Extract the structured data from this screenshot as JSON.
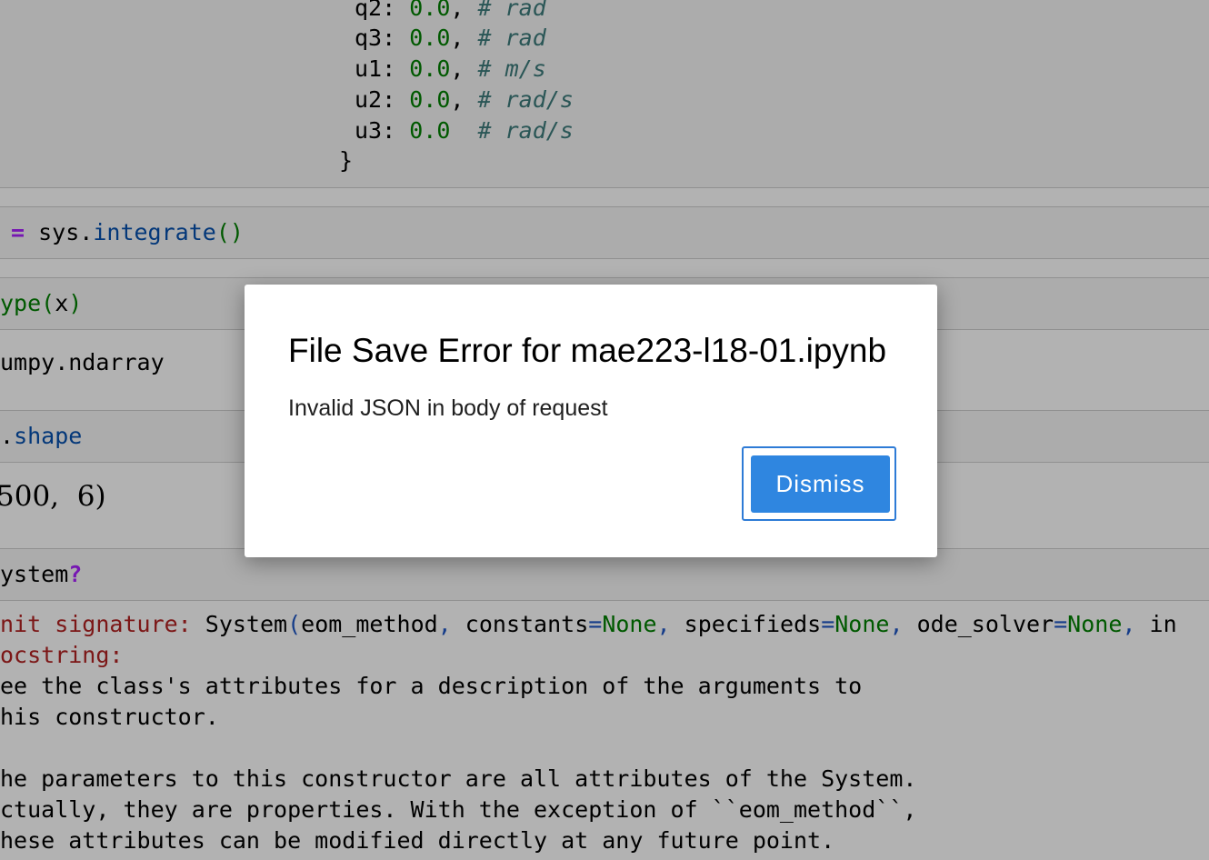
{
  "cell1": {
    "lines": [
      {
        "key": "q2",
        "value": "0.0",
        "sep": ",",
        "comment": "# rad"
      },
      {
        "key": "q3",
        "value": "0.0",
        "sep": ",",
        "comment": "# rad"
      },
      {
        "key": "u1",
        "value": "0.0",
        "sep": ",",
        "comment": "# m/s"
      },
      {
        "key": "u2",
        "value": "0.0",
        "sep": ",",
        "comment": "# rad/s"
      },
      {
        "key": "u3",
        "value": "0.0",
        "sep": " ",
        "comment": "# rad/s"
      }
    ],
    "closing": "}"
  },
  "cell2": {
    "op": "=",
    "obj": "sys",
    "dot": ".",
    "method": "integrate",
    "parens": "()"
  },
  "cell3": {
    "func": "ype",
    "open": "(",
    "arg": "x",
    "close": ")",
    "output": "umpy.ndarray"
  },
  "cell4": {
    "dot": ".",
    "attr": "shape",
    "output": "500,  6)"
  },
  "cell5": {
    "name": "ystem",
    "q": "?"
  },
  "help": {
    "sig_label": "nit signature:",
    "sig_class": "System",
    "sig_open": "(",
    "sig_args": [
      {
        "name": "eom_method",
        "eq": "",
        "val": "",
        "sep": ","
      },
      {
        "name": "constants",
        "eq": "=",
        "val": "None",
        "sep": ","
      },
      {
        "name": "specifieds",
        "eq": "=",
        "val": "None",
        "sep": ","
      },
      {
        "name": "ode_solver",
        "eq": "=",
        "val": "None",
        "sep": ","
      },
      {
        "name": "in",
        "eq": "",
        "val": "",
        "sep": ""
      }
    ],
    "doc_label": "ocstring:",
    "doc_lines": [
      "ee the class's attributes for a description of the arguments to",
      "his constructor.",
      "",
      "he parameters to this constructor are all attributes of the System.",
      "ctually, they are properties. With the exception of ``eom_method``,",
      "hese attributes can be modified directly at any future point."
    ]
  },
  "dialog": {
    "title": "File Save Error for mae223-l18-01.ipynb",
    "message": "Invalid JSON in body of request",
    "dismiss_label": "Dismiss"
  },
  "colors": {
    "dismiss_bg": "#2f86e0",
    "focus_ring": "#2e7bd6",
    "backdrop": "rgba(0,0,0,0.30)"
  }
}
